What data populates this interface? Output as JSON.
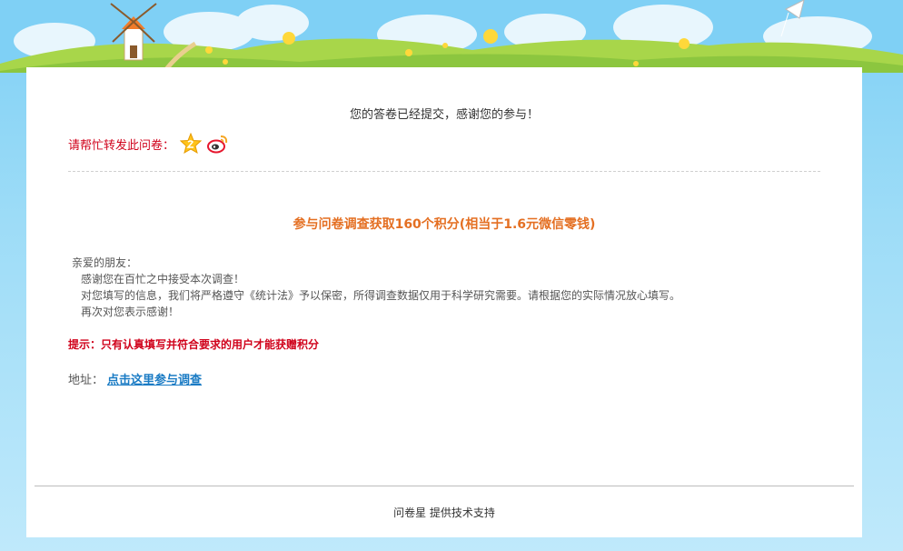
{
  "page": {
    "done_message": "您的答卷已经提交，感谢您的参与！",
    "share_label": "请帮忙转发此问卷：",
    "share_icons": [
      "star-icon",
      "weibo-icon"
    ],
    "reward_title": "参与问卷调查获取160个积分(相当于1.6元微信零钱)",
    "letter": {
      "greeting": "亲爱的朋友：",
      "line1": "感谢您在百忙之中接受本次调查！",
      "line2": "对您填写的信息，我们将严格遵守《统计法》予以保密，所得调查数据仅用于科学研究需要。请根据您的实际情况放心填写。",
      "line3": "再次对您表示感谢！"
    },
    "hint": "提示：只有认真填写并符合要求的用户才能获赠积分",
    "address_label": "地址：",
    "address_link": "点击这里参与调查",
    "footer": "问卷星 提供技术支持"
  },
  "colors": {
    "accent_orange": "#e46f22",
    "warning_red": "#d0021b",
    "link_blue": "#1a7bc4",
    "sky": "#7fd0f5",
    "grass": "#8cc63f"
  }
}
